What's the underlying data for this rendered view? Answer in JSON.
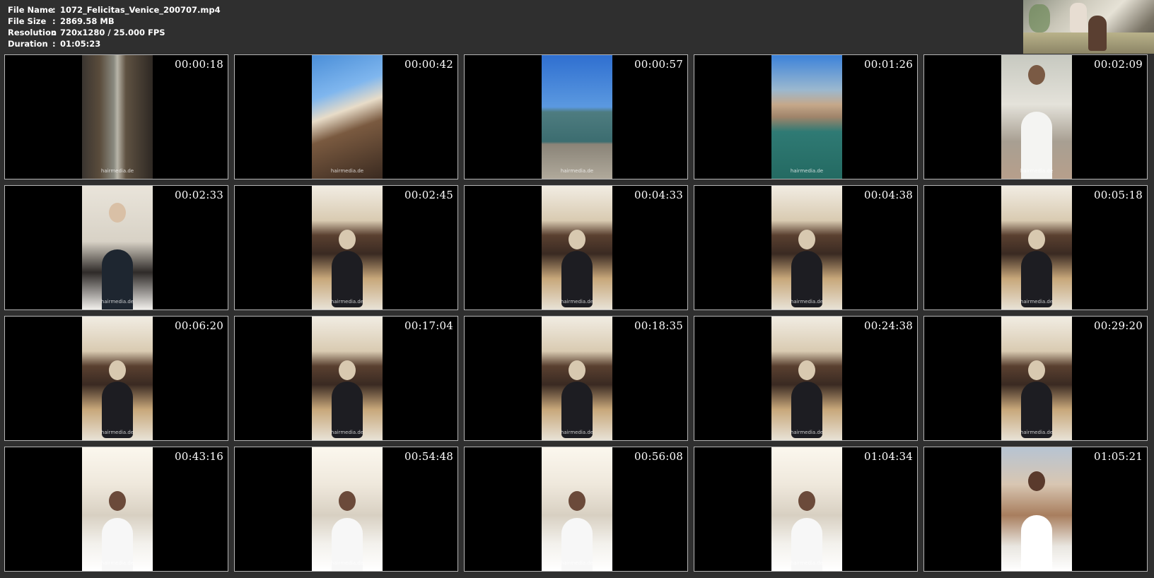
{
  "file_info": {
    "rows": [
      {
        "label": "File Name",
        "sep": ":",
        "value": "1072_Felicitas_Venice_200707.mp4"
      },
      {
        "label": "File Size",
        "sep": ":",
        "value": "2869.58 MB"
      },
      {
        "label": "Resolution",
        "sep": ":",
        "value": "720x1280 / 25.000 FPS"
      },
      {
        "label": "Duration",
        "sep": ":",
        "value": "01:05:23"
      }
    ]
  },
  "watermark": "hairmedia.de",
  "thumbnails": [
    {
      "time": "00:00:18",
      "scene": "alley"
    },
    {
      "time": "00:00:42",
      "scene": "stairs"
    },
    {
      "time": "00:00:57",
      "scene": "quay"
    },
    {
      "time": "00:01:26",
      "scene": "canal"
    },
    {
      "time": "00:02:09",
      "scene": "woman"
    },
    {
      "time": "00:02:33",
      "scene": "mask"
    },
    {
      "time": "00:02:45",
      "scene": "salon"
    },
    {
      "time": "00:04:33",
      "scene": "salon"
    },
    {
      "time": "00:04:38",
      "scene": "salon"
    },
    {
      "time": "00:05:18",
      "scene": "salon"
    },
    {
      "time": "00:06:20",
      "scene": "salon"
    },
    {
      "time": "00:17:04",
      "scene": "salon"
    },
    {
      "time": "00:18:35",
      "scene": "salon"
    },
    {
      "time": "00:24:38",
      "scene": "salon"
    },
    {
      "time": "00:29:20",
      "scene": "salon"
    },
    {
      "time": "00:43:16",
      "scene": "dry"
    },
    {
      "time": "00:54:48",
      "scene": "dry"
    },
    {
      "time": "00:56:08",
      "scene": "dry"
    },
    {
      "time": "01:04:34",
      "scene": "dry"
    },
    {
      "time": "01:05:21",
      "scene": "end"
    }
  ]
}
